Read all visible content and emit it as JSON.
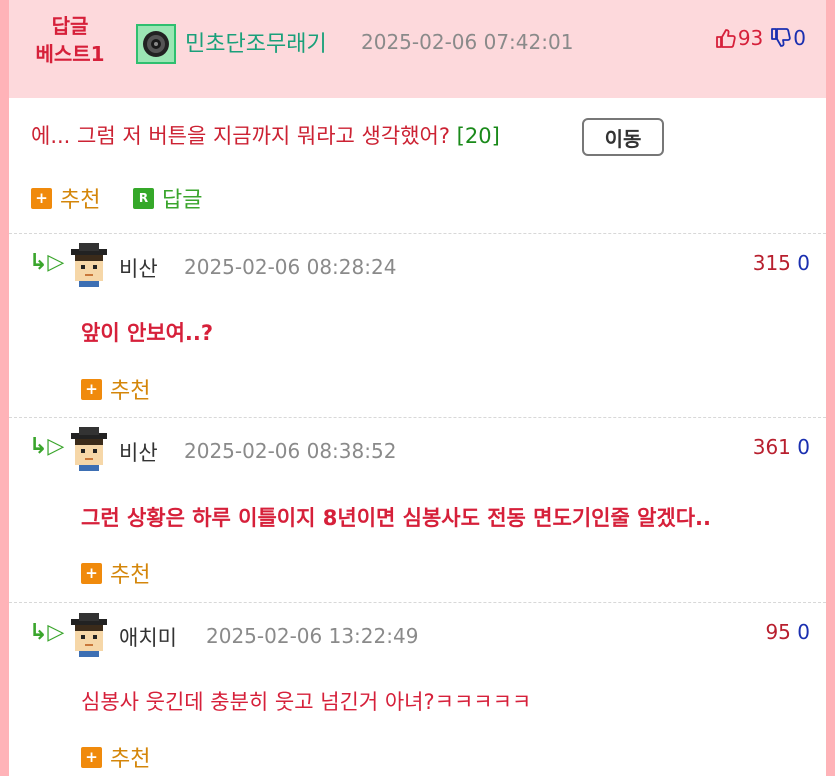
{
  "best": {
    "label_line1": "답글",
    "label_line2": "베스트1",
    "nickname": "민초단조무래기",
    "datetime": "2025-02-06 07:42:01",
    "up_count": "93",
    "down_count": "0"
  },
  "post": {
    "title": "에... 그럼 저 버튼을 지금까지 뭐라고 생각했어?",
    "comment_count": "[20]",
    "move_label": "이동",
    "recommend_label": "추천",
    "reply_label": "답글"
  },
  "comments": [
    {
      "nickname": "비산",
      "datetime": "2025-02-06 08:28:24",
      "up": "315",
      "down": "0",
      "text": "앞이 안보여..?",
      "recommend_label": "추천"
    },
    {
      "nickname": "비산",
      "datetime": "2025-02-06 08:38:52",
      "up": "361",
      "down": "0",
      "text": "그런 상황은 하루 이틀이지 8년이면 심봉사도 전동 면도기인줄 알겠다..",
      "recommend_label": "추천"
    },
    {
      "nickname": "애치미",
      "datetime": "2025-02-06 13:22:49",
      "up": "95",
      "down": "0",
      "text": "심봉사 웃긴데 충분히 웃고 넘긴거 아녀?ㅋㅋㅋㅋㅋ",
      "recommend_label": "추천"
    }
  ],
  "icons": {
    "reply_arrow": "reply-arrow-icon",
    "plus": "plus-icon",
    "r_badge": "R",
    "thumb_up": "thumbs-up-icon",
    "thumb_down": "thumbs-down-icon"
  },
  "colors": {
    "accent_red": "#d6203a",
    "accent_green": "#3aa52c",
    "vote_blue": "#1a2fb0",
    "recommend_orange": "#d4860a",
    "best_bg": "#fdd9dc"
  }
}
